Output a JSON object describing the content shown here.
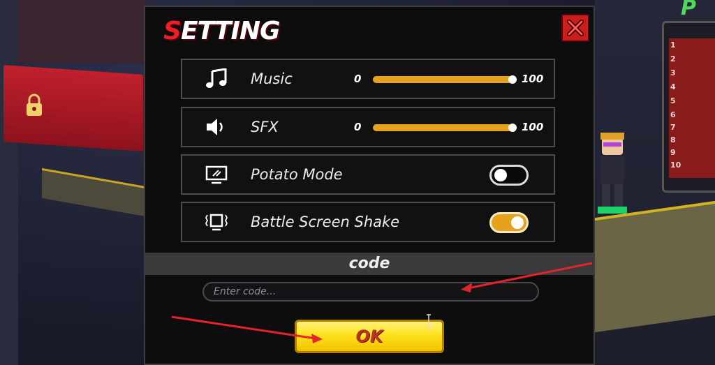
{
  "dialog": {
    "title_first": "S",
    "title_rest": "ETTING"
  },
  "settings": {
    "music": {
      "label": "Music",
      "min": "0",
      "max": "100",
      "value": 100,
      "icon": "music-note-icon"
    },
    "sfx": {
      "label": "SFX",
      "min": "0",
      "max": "100",
      "value": 100,
      "icon": "speaker-icon"
    },
    "potato": {
      "label": "Potato Mode",
      "enabled": false,
      "icon": "monitor-icon"
    },
    "shake": {
      "label": "Battle Screen Shake",
      "enabled": true,
      "icon": "screen-shake-icon"
    }
  },
  "code": {
    "header": "code",
    "placeholder": "Enter code...",
    "value": ""
  },
  "ok_button": {
    "label": "OK"
  },
  "colors": {
    "accent_orange": "#e6a21c",
    "title_red": "#ee1d26",
    "ok_yellow": "#ffe21c",
    "close_red": "#cc1d1f",
    "arrow_red": "#e3242b"
  },
  "background": {
    "leaderboard_ranks": [
      "1",
      "2",
      "3",
      "4",
      "5",
      "6",
      "7",
      "8",
      "9",
      "10"
    ]
  }
}
